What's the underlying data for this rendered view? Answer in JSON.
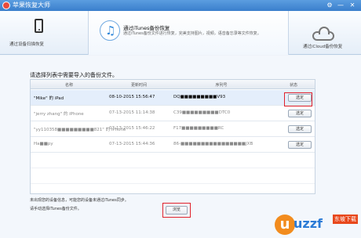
{
  "window": {
    "title": "苹果恢复大师",
    "controls": [
      "⚙",
      "—",
      "✕"
    ]
  },
  "tabs": {
    "device": {
      "label": "通过设备扫描恢复",
      "icon": "iphone-icon"
    },
    "itunes": {
      "title": "通过iTunes备份恢复",
      "description": "通过iTunes备份文件进行恢复，完美支持图片，视频，语音备忘录等文件恢复。",
      "icon": "music-note-icon"
    },
    "icloud": {
      "label": "通过iCloud备份恢复",
      "icon": "cloud-icon"
    }
  },
  "main": {
    "heading": "请选择列表中需要导入的备份文件。",
    "columns": [
      "名称",
      "更新时间",
      "序列号",
      "状态"
    ],
    "rows": [
      {
        "name": "\"Mike\" 的 iPad",
        "time": "08-10-2015 15:56:47",
        "serial": "DQ■■■■■■■■■V93",
        "action": "选定"
      },
      {
        "name": "\"jerry zhang\" 的 iPhone",
        "time": "07-13-2015 11:14:38",
        "serial": "C39■■■■■■■■■DTC0",
        "action": "选定"
      },
      {
        "name": "\"yy110358■■■■■■■■■821\" 的 iPhone",
        "time": "07-13-2015 15:46:22",
        "serial": "F17■■■■■■■■■RC",
        "action": "选定"
      },
      {
        "name": "Ha■■py",
        "time": "07-13-2015 15:44:36",
        "serial": "86-■■■■■■■■■■■■■■■■JXB",
        "action": "选定"
      }
    ],
    "hint1": "未出现您的设备信息，可能您的设备未通过iTunes同步。",
    "hint2": "请手动选择iTunes备份文件。",
    "browse_label": "浏览"
  },
  "watermark": {
    "brand": "uzzf",
    "suffix": ".com",
    "tag": "东坡下载"
  },
  "colors": {
    "accent": "#3a7fcc",
    "highlight": "#e0212b"
  }
}
